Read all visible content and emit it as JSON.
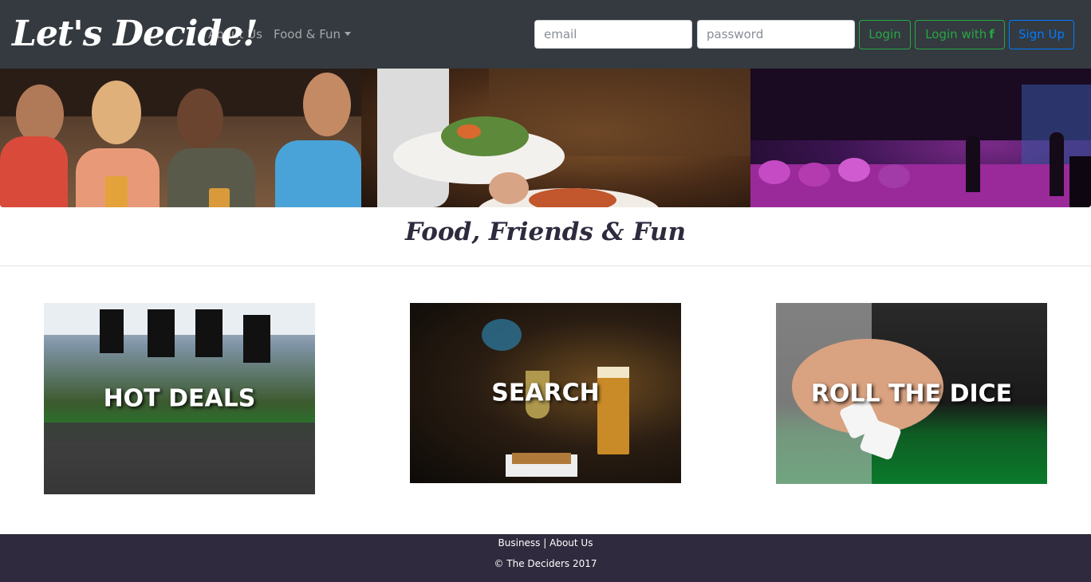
{
  "navbar": {
    "brand": "Let's Decide!",
    "links": [
      {
        "label": "About Us"
      },
      {
        "label": "Food & Fun"
      }
    ],
    "email_placeholder": "email",
    "password_placeholder": "password",
    "login_label": "Login",
    "login_fb_label": "Login with",
    "fb_icon_glyph": "f",
    "signup_label": "Sign Up"
  },
  "tagline": "Food, Friends & Fun",
  "cards": [
    {
      "label": "HOT DEALS",
      "icon": "stadium-photo"
    },
    {
      "label": "SEARCH",
      "icon": "bar-drinks-photo"
    },
    {
      "label": "ROLL THE DICE",
      "icon": "dice-photo"
    }
  ],
  "footer": {
    "business_link": "Business",
    "separator": "|",
    "about_link": "About Us",
    "copyright": "© The Deciders 2017"
  },
  "colors": {
    "navbar_bg": "#343a40",
    "footer_bg": "#2f2a3d",
    "success": "#28a745",
    "primary": "#007bff"
  }
}
